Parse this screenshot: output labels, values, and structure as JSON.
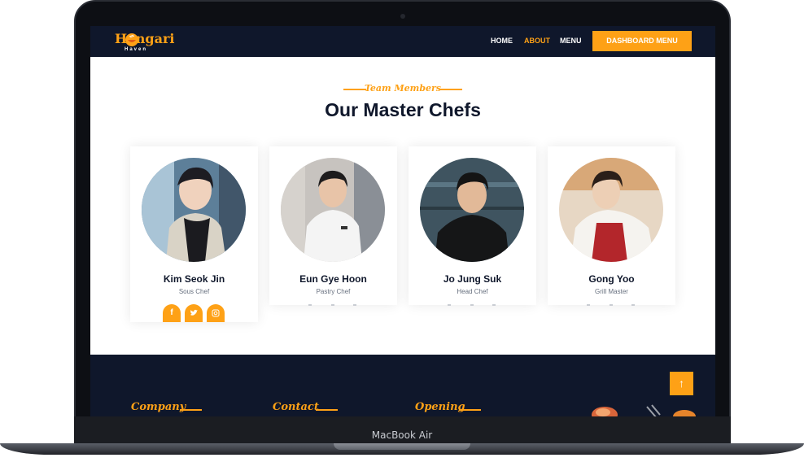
{
  "device": {
    "label": "MacBook Air"
  },
  "brand": {
    "logo_text": "Hongari",
    "logo_subtext": "Haven"
  },
  "nav": {
    "items": [
      {
        "label": "HOME"
      },
      {
        "label": "ABOUT"
      },
      {
        "label": "MENU"
      }
    ],
    "cta_label": "DASHBOARD MENU",
    "active_item": "ABOUT"
  },
  "team": {
    "eyebrow": "Team Members",
    "title": "Our Master Chefs",
    "chefs": [
      {
        "name": "Kim Seok Jin",
        "role": "Sous Chef"
      },
      {
        "name": "Eun Gye Hoon",
        "role": "Pastry Chef"
      },
      {
        "name": "Jo Jung Suk",
        "role": "Head Chef"
      },
      {
        "name": "Gong Yoo",
        "role": "Grill Master"
      }
    ],
    "social_icons": [
      "facebook-icon",
      "twitter-icon",
      "instagram-icon"
    ]
  },
  "footer": {
    "headings": [
      "Company",
      "Contact",
      "Opening"
    ],
    "back_to_top_icon": "arrow-up-icon"
  },
  "colors": {
    "accent": "#fea116",
    "dark": "#0f172b",
    "white": "#ffffff"
  }
}
